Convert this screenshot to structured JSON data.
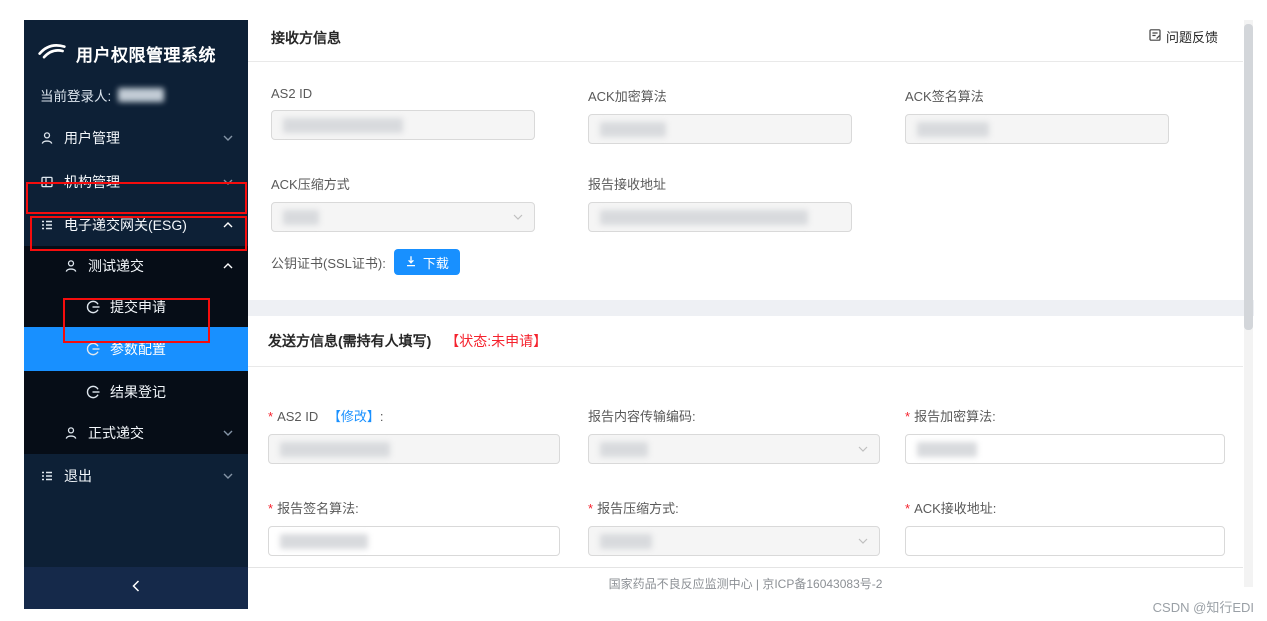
{
  "app_title": "用户权限管理系统",
  "ui": {
    "star": "*",
    "feedback_label": "问题反馈",
    "icons": [
      "swoosh-logo-icon",
      "person-icon",
      "org-icon",
      "list-icon",
      "circle-arrow-icon",
      "chevron-down-icon",
      "chevron-up-icon",
      "feedback-icon",
      "download-icon",
      "collapse-left-icon",
      "select-caret-icon"
    ],
    "colors": {
      "accent": "#1890ff",
      "danger": "#f5222d",
      "annotation_red": "#f50d0d",
      "sidebar_bg": "#0d2036",
      "submenu_bg": "#060d17",
      "disabled_bg": "#f5f5f5"
    }
  },
  "sidebar": {
    "logo_title": "用户权限管理系统",
    "current_user_label": "当前登录人:",
    "items": [
      {
        "label": "用户管理"
      },
      {
        "label": "机构管理"
      },
      {
        "label": "电子递交网关(ESG)"
      },
      {
        "label": "测试递交"
      },
      {
        "label": "提交申请"
      },
      {
        "label": "参数配置"
      },
      {
        "label": "结果登记"
      },
      {
        "label": "正式递交"
      },
      {
        "label": "退出"
      }
    ],
    "selected_item": "参数配置"
  },
  "receiver": {
    "title": "接收方信息",
    "fields": {
      "as2_id": {
        "label": "AS2 ID"
      },
      "ack_encrypt": {
        "label": "ACK加密算法"
      },
      "ack_sign": {
        "label": "ACK签名算法"
      },
      "ack_compress": {
        "label": "ACK压缩方式"
      },
      "report_addr": {
        "label": "报告接收地址"
      }
    },
    "cert_label": "公钥证书(SSL证书):",
    "download_label": "下载"
  },
  "sender": {
    "title": "发送方信息(需持有人填写)",
    "status": "【状态:未申请】",
    "fields": {
      "as2_id": {
        "label": "AS2 ID",
        "modify_link": "【修改】",
        "colon": ":"
      },
      "encoding": {
        "label": "报告内容传输编码:"
      },
      "report_encrypt": {
        "label": "报告加密算法:"
      },
      "report_sign": {
        "label": "报告签名算法:"
      },
      "report_compress": {
        "label": "报告压缩方式:"
      },
      "ack_addr": {
        "label": "ACK接收地址:"
      }
    }
  },
  "footer": {
    "text": "国家药品不良反应监测中心 | 京ICP备16043083号-2"
  },
  "watermark": "CSDN @知行EDI"
}
